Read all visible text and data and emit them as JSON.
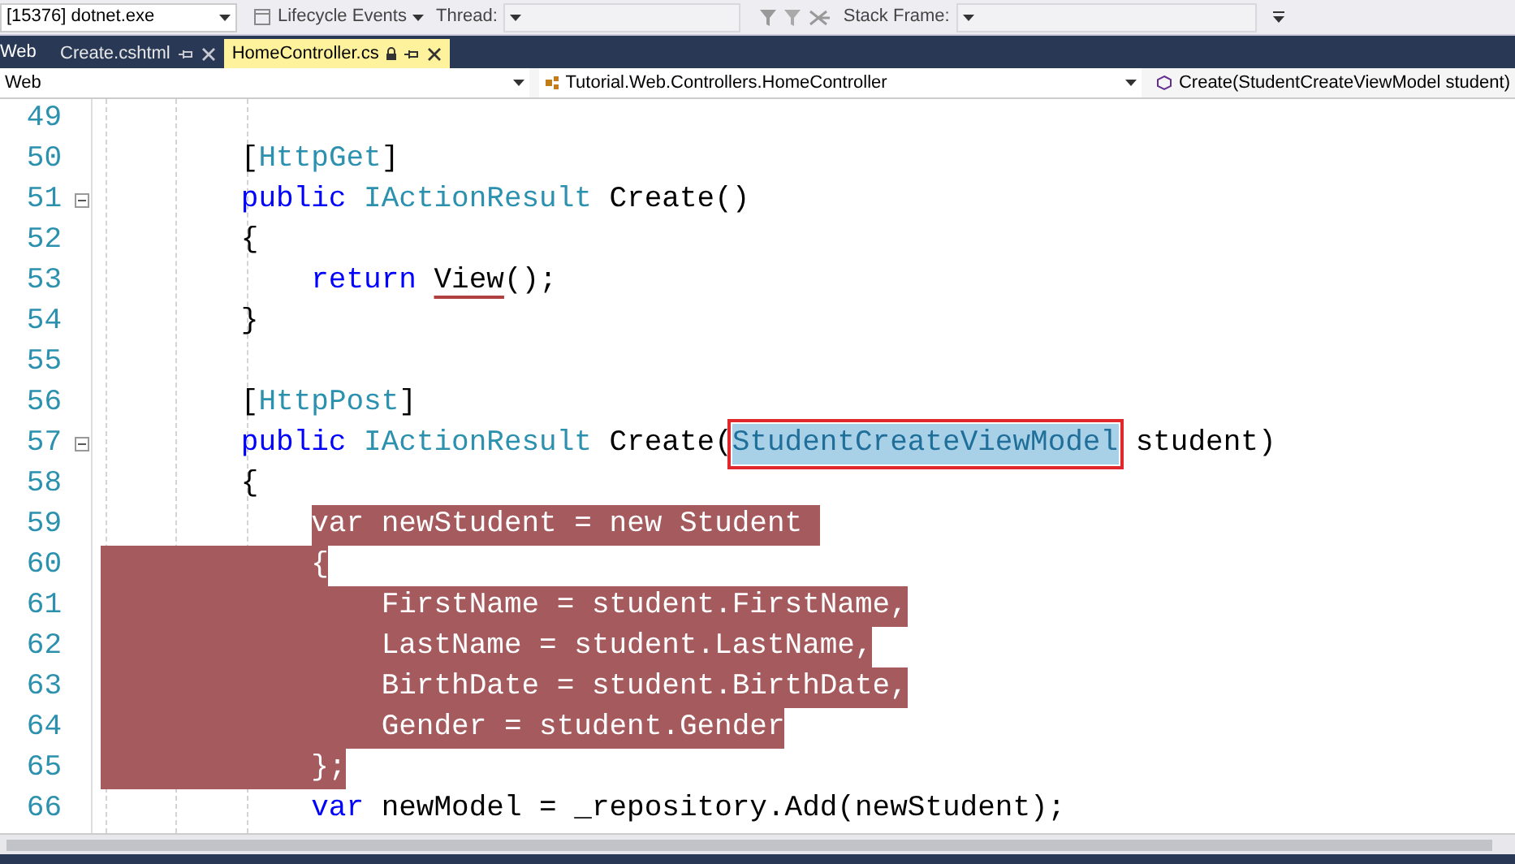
{
  "debug_toolbar": {
    "process": "[15376] dotnet.exe",
    "lifecycle_events": "Lifecycle Events",
    "thread_label": "Thread:",
    "stack_frame_label": "Stack Frame:"
  },
  "tab_bar": {
    "project_label": "Web",
    "tabs": [
      {
        "label": "Create.cshtml",
        "selected": false,
        "locked": false
      },
      {
        "label": "HomeController.cs",
        "selected": true,
        "locked": true
      }
    ]
  },
  "navigation_bar": {
    "project": "Web",
    "class": "Tutorial.Web.Controllers.HomeController",
    "member": "Create(StudentCreateViewModel student)"
  },
  "editor": {
    "lines": [
      {
        "number": "49"
      },
      {
        "number": "50",
        "selected": false,
        "tokens": [
          {
            "kind": "plain",
            "text": "        ["
          },
          {
            "kind": "type",
            "text": "HttpGet"
          },
          {
            "kind": "plain",
            "text": "]"
          }
        ]
      },
      {
        "number": "51",
        "foldable": true,
        "selected": false,
        "tokens": [
          {
            "kind": "kw",
            "text": "        public"
          },
          {
            "kind": "type",
            "text": " IActionResult"
          },
          {
            "kind": "plain",
            "text": " Create()"
          }
        ]
      },
      {
        "number": "52",
        "selected": false,
        "tokens": [
          {
            "kind": "plain",
            "text": "        {"
          }
        ]
      },
      {
        "number": "53",
        "selected": false,
        "tokens": [
          {
            "kind": "kw",
            "text": "            return "
          },
          {
            "kind": "plain",
            "text": "View",
            "squiggle": true
          },
          {
            "kind": "plain",
            "text": "();"
          }
        ]
      },
      {
        "number": "54",
        "selected": false,
        "tokens": [
          {
            "kind": "plain",
            "text": "        }"
          }
        ]
      },
      {
        "number": "55"
      },
      {
        "number": "56",
        "selected": false,
        "tokens": [
          {
            "kind": "plain",
            "text": "        ["
          },
          {
            "kind": "type",
            "text": "HttpPost"
          },
          {
            "kind": "plain",
            "text": "]"
          }
        ]
      },
      {
        "number": "57",
        "foldable": true,
        "selected": false,
        "tokens": [
          {
            "kind": "kw",
            "text": "        public"
          },
          {
            "kind": "type",
            "text": " IActionResult"
          },
          {
            "kind": "plain",
            "text": " Create("
          },
          {
            "kind": "type",
            "text": "StudentCreateViewModel",
            "highlighted": true,
            "boxed": true
          },
          {
            "kind": "plain",
            "text": " student)"
          }
        ]
      },
      {
        "number": "58",
        "selected": false,
        "tokens": [
          {
            "kind": "plain",
            "text": "        {"
          }
        ]
      },
      {
        "number": "59",
        "selected": true,
        "tokens": [
          {
            "kind": "kw",
            "text": "            var"
          },
          {
            "kind": "plain",
            "text": " newStudent = "
          },
          {
            "kind": "kw",
            "text": "new"
          },
          {
            "kind": "type",
            "text": " Student "
          }
        ]
      },
      {
        "number": "60",
        "selected": true,
        "tokens": [
          {
            "kind": "plain",
            "text": "            {"
          }
        ]
      },
      {
        "number": "61",
        "selected": true,
        "tokens": [
          {
            "kind": "plain",
            "text": "                FirstName = student.FirstName,"
          }
        ]
      },
      {
        "number": "62",
        "selected": true,
        "tokens": [
          {
            "kind": "plain",
            "text": "                LastName = student.LastName,"
          }
        ]
      },
      {
        "number": "63",
        "selected": true,
        "tokens": [
          {
            "kind": "plain",
            "text": "                BirthDate = student.BirthDate,"
          }
        ]
      },
      {
        "number": "64",
        "selected": true,
        "tokens": [
          {
            "kind": "plain",
            "text": "                Gender = student.Gender"
          }
        ]
      },
      {
        "number": "65",
        "selected": true,
        "tokens": [
          {
            "kind": "plain",
            "text": "            };"
          }
        ]
      },
      {
        "number": "66",
        "selected": false,
        "tokens": [
          {
            "kind": "kw",
            "text": "            var"
          },
          {
            "kind": "plain",
            "text": " newModel = _repository.Add(newStudent);"
          }
        ]
      }
    ]
  }
}
